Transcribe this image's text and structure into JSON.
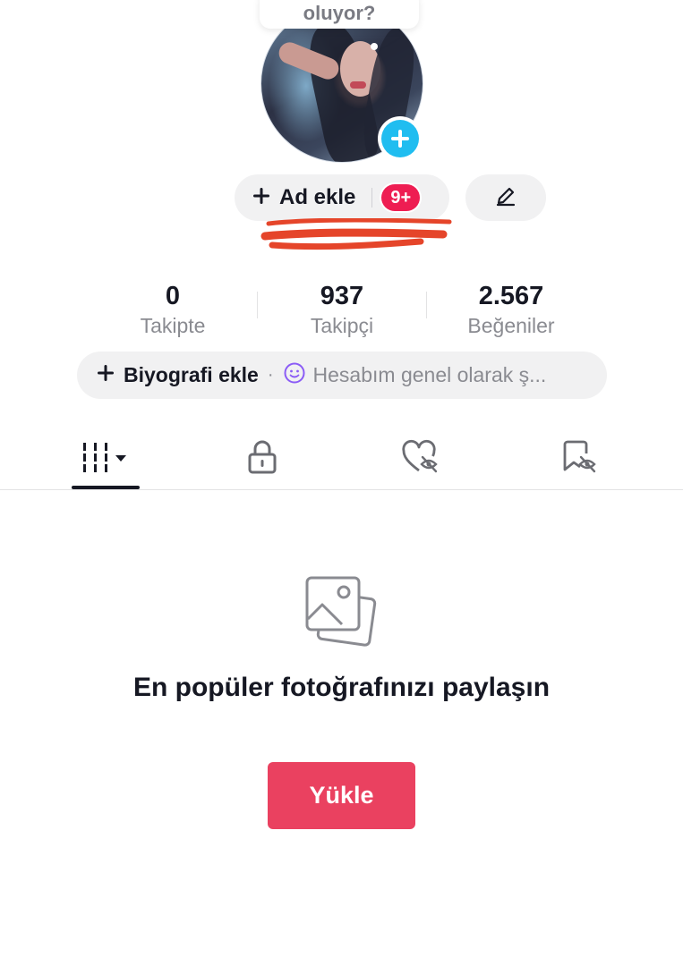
{
  "bubble": {
    "text": "oluyor?"
  },
  "profile": {
    "name_label": "Ad ekle",
    "notifications_badge": "9+"
  },
  "stats": [
    {
      "value": "0",
      "label": "Takipte"
    },
    {
      "value": "937",
      "label": "Takipçi"
    },
    {
      "value": "2.567",
      "label": "Beğeniler"
    }
  ],
  "bio": {
    "label": "Biyografi ekle",
    "separator": "·",
    "suggestion": "Hesabım genel olarak ş..."
  },
  "tabs": [
    {
      "icon": "grid-icon",
      "active": true
    },
    {
      "icon": "lock-icon",
      "active": false
    },
    {
      "icon": "liked-hidden-icon",
      "active": false
    },
    {
      "icon": "saved-hidden-icon",
      "active": false
    }
  ],
  "empty_state": {
    "title": "En popüler fotoğrafınızı paylaşın",
    "button_label": "Yükle"
  },
  "colors": {
    "accent": "#ea4160",
    "badge": "#ee1d52",
    "add_avatar": "#20bdf0",
    "scribble": "#e5452a"
  }
}
